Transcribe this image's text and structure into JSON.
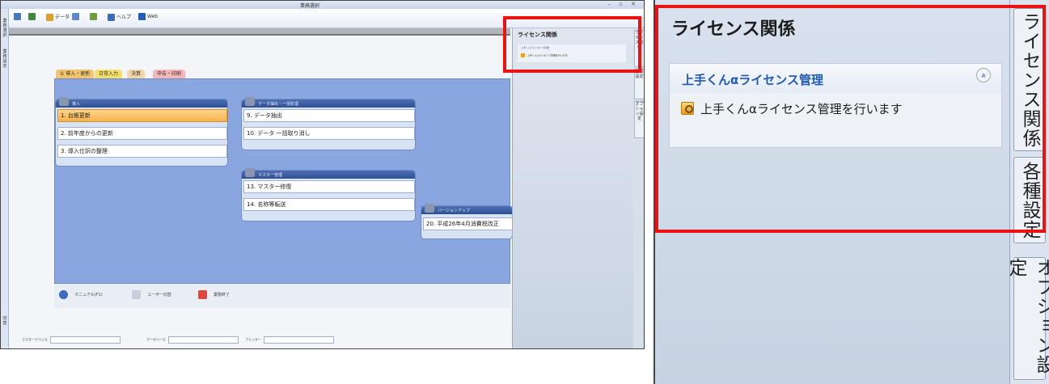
{
  "left": {
    "window_title": "業務選択",
    "window_controls": "– ▫ ✕",
    "toolbar": [
      {
        "label": "",
        "icon": "app-icon",
        "color": "#4a78c2"
      },
      {
        "label": "",
        "icon": "tree-icon",
        "color": "#3d8a3d"
      },
      {
        "label": "データ",
        "icon": "data-icon",
        "color": "#e2a020"
      },
      {
        "label": "",
        "icon": "import-icon",
        "color": "#5a8bd0"
      },
      {
        "label": "",
        "icon": "export-icon",
        "color": "#6e9f3a"
      },
      {
        "label": "ヘルプ",
        "icon": "help-icon",
        "color": "#3a6cc0"
      },
      {
        "label": "Web",
        "icon": "web-icon",
        "color": "#1f5fb8"
      }
    ],
    "left_strip": [
      "業務選択",
      "業務設定",
      "切替"
    ],
    "tabs": [
      "① 導入・更新",
      "日常入力",
      "決算",
      "申告・印刷"
    ],
    "groups": [
      {
        "title": "導入",
        "buttons": [
          "1. 台帳更新",
          "2. 前年度からの更新",
          "3. 導入仕訳の整理"
        ]
      },
      {
        "title": "データ抽出・一括処理",
        "buttons": [
          "9. データ抽出",
          "10. データ 一括取り消し"
        ]
      },
      {
        "title": "マスター管理",
        "buttons": [
          "13. マスター修復",
          "14. 名称等転送"
        ]
      },
      {
        "title": "バージョンアップ",
        "buttons": [
          "20. 平成26年4月消費税改正"
        ]
      }
    ],
    "bottom_buttons": [
      "マニュアル(F1)",
      "ユーザー切替",
      "業務終了"
    ],
    "status_fields": [
      {
        "label": "マスターデバイス",
        "value": ""
      },
      {
        "label": "データベース",
        "value": ""
      },
      {
        "label": "プリンター",
        "value": ""
      }
    ],
    "right_pane": {
      "title": "ライセンス関係",
      "sub_title": "上手くんαライセンス管理",
      "sub_item": "上手くんαライセンス管理を行います"
    },
    "right_tabs": [
      "ライセンス関係",
      "各種設定",
      "オプション設定"
    ]
  },
  "zoom": {
    "title": "ライセンス関係",
    "section_title": "上手くんαライセンス管理",
    "collapse_glyph": "«",
    "item_text": "上手くんαライセンス管理を行います",
    "item_icon": "license-key-icon",
    "side_tabs": [
      "ライセンス関係",
      "各種設定",
      "オプション設定"
    ]
  },
  "colors": {
    "highlight_red": "#ee1111",
    "panel_blue": "#8aa6e0",
    "section_title_blue": "#1f5ab4",
    "selected_orange": "#f7b24c"
  }
}
